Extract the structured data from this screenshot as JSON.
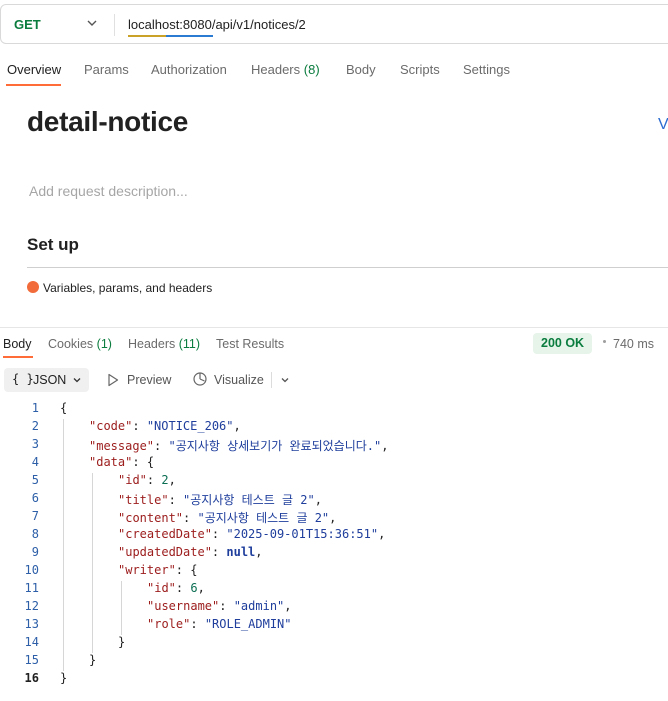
{
  "request": {
    "method": "GET",
    "url": "localhost:8080/api/v1/notices/2",
    "tabs": [
      {
        "label": "Overview",
        "count": ""
      },
      {
        "label": "Params",
        "count": ""
      },
      {
        "label": "Authorization",
        "count": ""
      },
      {
        "label": "Headers",
        "count": "(8)"
      },
      {
        "label": "Body",
        "count": ""
      },
      {
        "label": "Scripts",
        "count": ""
      },
      {
        "label": "Settings",
        "count": ""
      }
    ],
    "active_tab": "Overview"
  },
  "overview": {
    "title": "detail-notice",
    "view_link": "V",
    "description_placeholder": "Add request description...",
    "setup_title": "Set up",
    "setup_item": "Variables, params, and headers"
  },
  "response": {
    "tabs": [
      {
        "label": "Body",
        "count": ""
      },
      {
        "label": "Cookies",
        "count": "(1)"
      },
      {
        "label": "Headers",
        "count": "(11)"
      },
      {
        "label": "Test Results",
        "count": ""
      }
    ],
    "status": "200 OK",
    "time": "740 ms",
    "format": "JSON",
    "format_icon": "{ }",
    "preview_label": "Preview",
    "visualize_label": "Visualize"
  },
  "code_lines": [
    {
      "n": "1",
      "indent": 0,
      "key": "",
      "sep": "",
      "value": "{",
      "vtype": "p",
      "tail": ""
    },
    {
      "n": "2",
      "indent": 1,
      "key": "\"code\"",
      "sep": ": ",
      "value": "\"NOTICE_206\"",
      "vtype": "s",
      "tail": ","
    },
    {
      "n": "3",
      "indent": 1,
      "key": "\"message\"",
      "sep": ": ",
      "value": "\"공지사항 상세보기가 완료되었습니다.\"",
      "vtype": "s",
      "tail": ","
    },
    {
      "n": "4",
      "indent": 1,
      "key": "\"data\"",
      "sep": ": ",
      "value": "{",
      "vtype": "p",
      "tail": ""
    },
    {
      "n": "5",
      "indent": 2,
      "key": "\"id\"",
      "sep": ": ",
      "value": "2",
      "vtype": "n",
      "tail": ","
    },
    {
      "n": "6",
      "indent": 2,
      "key": "\"title\"",
      "sep": ": ",
      "value": "\"공지사항 테스트 글 2\"",
      "vtype": "s",
      "tail": ","
    },
    {
      "n": "7",
      "indent": 2,
      "key": "\"content\"",
      "sep": ": ",
      "value": "\"공지사항 테스트 글 2\"",
      "vtype": "s",
      "tail": ","
    },
    {
      "n": "8",
      "indent": 2,
      "key": "\"createdDate\"",
      "sep": ": ",
      "value": "\"2025-09-01T15:36:51\"",
      "vtype": "s",
      "tail": ","
    },
    {
      "n": "9",
      "indent": 2,
      "key": "\"updatedDate\"",
      "sep": ": ",
      "value": "null",
      "vtype": "kw",
      "tail": ","
    },
    {
      "n": "10",
      "indent": 2,
      "key": "\"writer\"",
      "sep": ": ",
      "value": "{",
      "vtype": "p",
      "tail": ""
    },
    {
      "n": "11",
      "indent": 3,
      "key": "\"id\"",
      "sep": ": ",
      "value": "6",
      "vtype": "n",
      "tail": ","
    },
    {
      "n": "12",
      "indent": 3,
      "key": "\"username\"",
      "sep": ": ",
      "value": "\"admin\"",
      "vtype": "s",
      "tail": ","
    },
    {
      "n": "13",
      "indent": 3,
      "key": "\"role\"",
      "sep": ": ",
      "value": "\"ROLE_ADMIN\"",
      "vtype": "s",
      "tail": ""
    },
    {
      "n": "14",
      "indent": 2,
      "key": "",
      "sep": "",
      "value": "}",
      "vtype": "p",
      "tail": ""
    },
    {
      "n": "15",
      "indent": 1,
      "key": "",
      "sep": "",
      "value": "}",
      "vtype": "p",
      "tail": ""
    },
    {
      "n": "16",
      "indent": 0,
      "key": "",
      "sep": "",
      "value": "}",
      "vtype": "p",
      "tail": "",
      "current": true
    }
  ],
  "colors": {
    "accent": "#ff6c37",
    "method_get": "#0a7c3e",
    "status_ok_bg": "#e6f4ea",
    "setup_dot": "#f26b3a"
  },
  "icons": [
    "chevron-down-icon",
    "braces-icon",
    "play-icon",
    "visualize-icon"
  ]
}
